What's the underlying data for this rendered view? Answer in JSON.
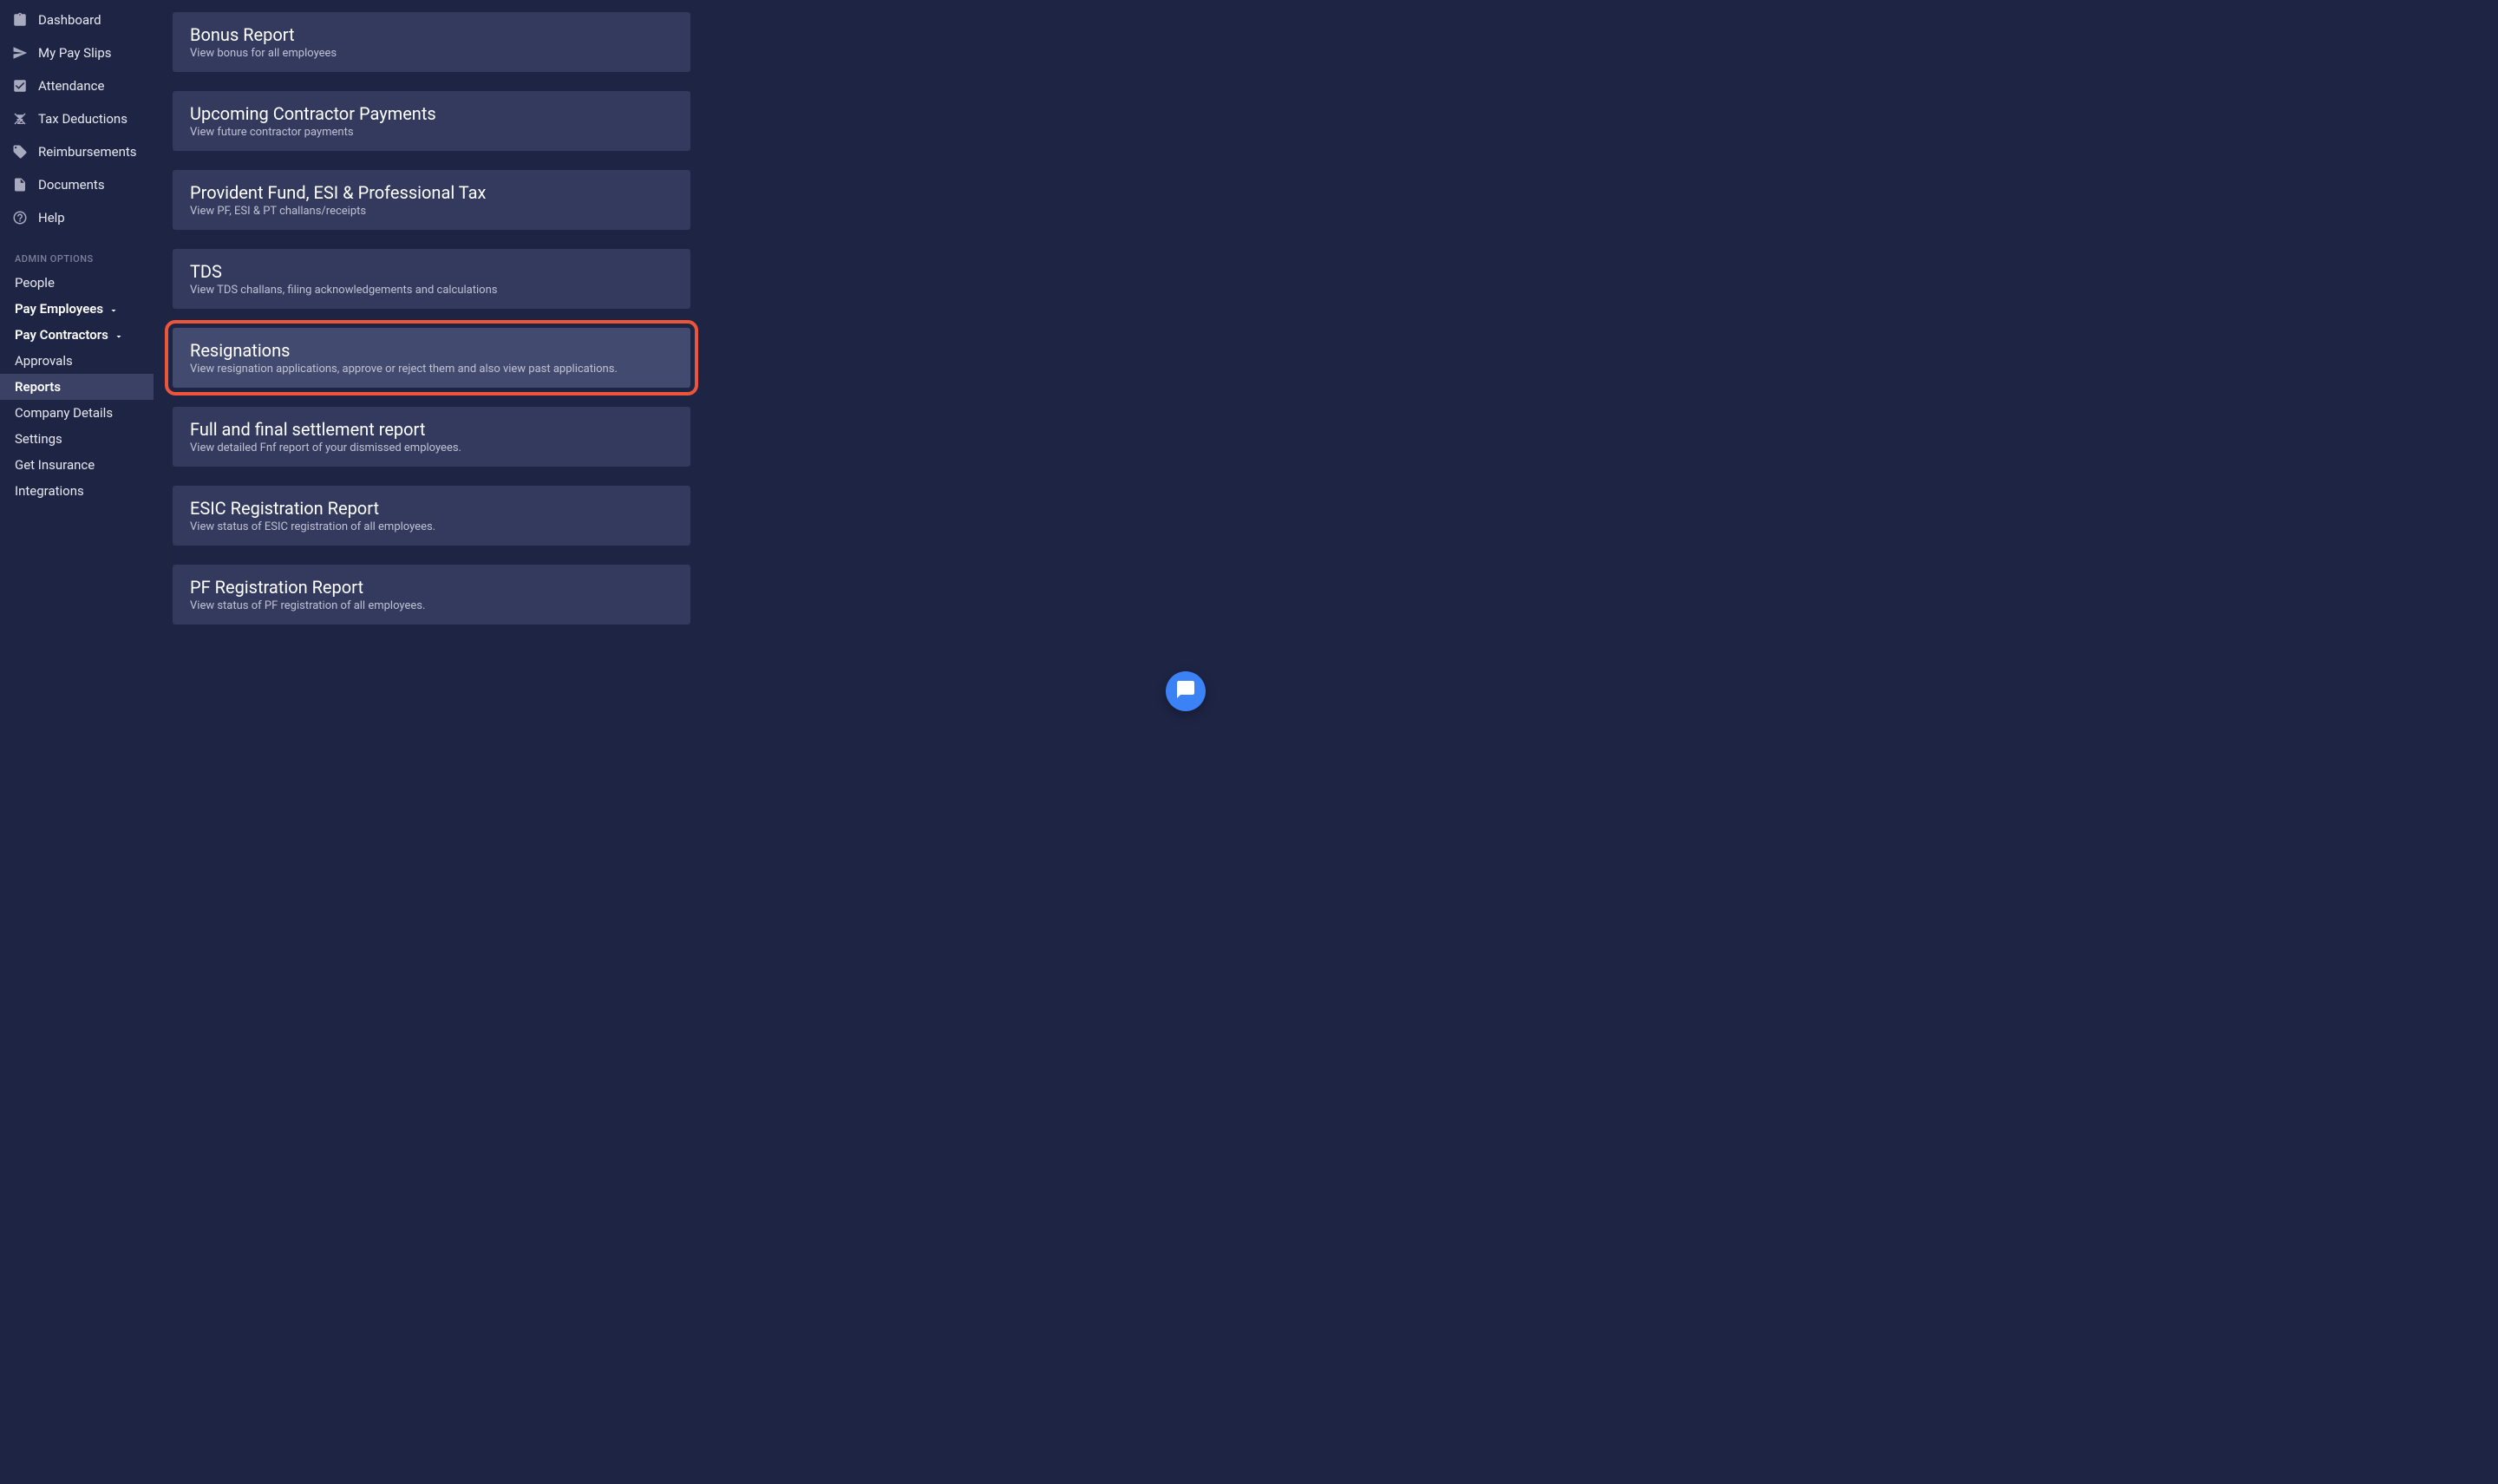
{
  "sidebar": {
    "nav": [
      {
        "icon": "clipboard",
        "label": "Dashboard"
      },
      {
        "icon": "send",
        "label": "My Pay Slips"
      },
      {
        "icon": "checkbox",
        "label": "Attendance"
      },
      {
        "icon": "calc",
        "label": "Tax Deductions"
      },
      {
        "icon": "tag",
        "label": "Reimbursements"
      },
      {
        "icon": "doc",
        "label": "Documents"
      },
      {
        "icon": "question",
        "label": "Help"
      }
    ],
    "sectionHeader": "ADMIN OPTIONS",
    "admin": [
      {
        "label": "People",
        "bold": false,
        "expandable": false,
        "active": false
      },
      {
        "label": "Pay Employees",
        "bold": true,
        "expandable": true,
        "active": false
      },
      {
        "label": "Pay Contractors",
        "bold": true,
        "expandable": true,
        "active": false
      },
      {
        "label": "Approvals",
        "bold": false,
        "expandable": false,
        "active": false
      },
      {
        "label": "Reports",
        "bold": true,
        "expandable": false,
        "active": true
      },
      {
        "label": "Company Details",
        "bold": false,
        "expandable": false,
        "active": false
      },
      {
        "label": "Settings",
        "bold": false,
        "expandable": false,
        "active": false
      },
      {
        "label": "Get Insurance",
        "bold": false,
        "expandable": false,
        "active": false
      },
      {
        "label": "Integrations",
        "bold": false,
        "expandable": false,
        "active": false
      }
    ]
  },
  "reports": [
    {
      "title": "Bonus Report",
      "desc": "View bonus for all employees",
      "highlighted": false
    },
    {
      "title": "Upcoming Contractor Payments",
      "desc": "View future contractor payments",
      "highlighted": false
    },
    {
      "title": "Provident Fund, ESI & Professional Tax",
      "desc": "View PF, ESI & PT challans/receipts",
      "highlighted": false
    },
    {
      "title": "TDS",
      "desc": "View TDS challans, filing acknowledgements and calculations",
      "highlighted": false
    },
    {
      "title": "Resignations",
      "desc": "View resignation applications, approve or reject them and also view past applications.",
      "highlighted": true
    },
    {
      "title": "Full and final settlement report",
      "desc": "View detailed Fnf report of your dismissed employees.",
      "highlighted": false
    },
    {
      "title": "ESIC Registration Report",
      "desc": "View status of ESIC registration of all employees.",
      "highlighted": false
    },
    {
      "title": "PF Registration Report",
      "desc": "View status of PF registration of all employees.",
      "highlighted": false
    }
  ]
}
